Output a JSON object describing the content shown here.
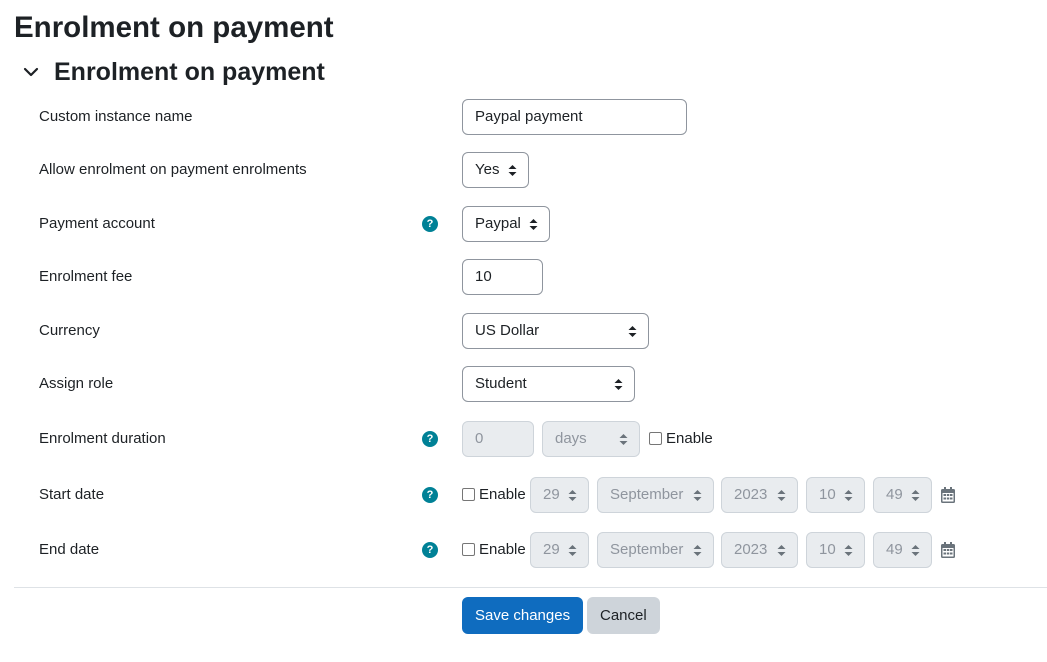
{
  "page": {
    "title": "Enrolment on payment"
  },
  "section": {
    "title": "Enrolment on payment"
  },
  "fields": {
    "instance_name": {
      "label": "Custom instance name",
      "value": "Paypal payment"
    },
    "allow": {
      "label": "Allow enrolment on payment enrolments",
      "value": "Yes"
    },
    "account": {
      "label": "Payment account",
      "value": "Paypal"
    },
    "fee": {
      "label": "Enrolment fee",
      "value": "10"
    },
    "currency": {
      "label": "Currency",
      "value": "US Dollar"
    },
    "role": {
      "label": "Assign role",
      "value": "Student"
    },
    "duration": {
      "label": "Enrolment duration",
      "value": "0",
      "unit": "days",
      "enable_label": "Enable"
    },
    "start_date": {
      "label": "Start date",
      "enable_label": "Enable",
      "day": "29",
      "month": "September",
      "year": "2023",
      "hour": "10",
      "minute": "49"
    },
    "end_date": {
      "label": "End date",
      "enable_label": "Enable",
      "day": "29",
      "month": "September",
      "year": "2023",
      "hour": "10",
      "minute": "49"
    }
  },
  "help_glyph": "?",
  "buttons": {
    "save": "Save changes",
    "cancel": "Cancel"
  },
  "colors": {
    "primary": "#0f6cbf",
    "help": "#008196",
    "secondary": "#ced4da"
  },
  "icons": [
    "chevron-down-icon",
    "help-icon",
    "select-arrows-icon",
    "calendar-icon"
  ]
}
